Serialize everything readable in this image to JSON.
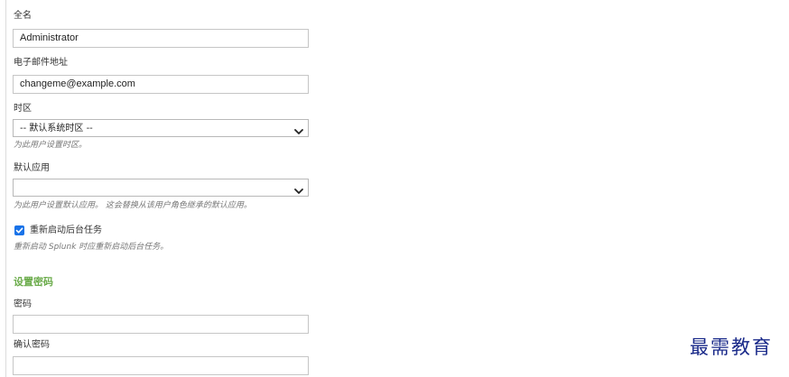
{
  "form": {
    "full_name": {
      "label": "全名",
      "value": "Administrator"
    },
    "email": {
      "label": "电子邮件地址",
      "value": "changeme@example.com"
    },
    "timezone": {
      "label": "时区",
      "selected": "-- 默认系统时区 --",
      "help": "为此用户设置时区。"
    },
    "default_app": {
      "label": "默认应用",
      "selected": "",
      "help": "为此用户设置默认应用。 这会替换从该用户角色继承的默认应用。"
    },
    "restart_background_jobs": {
      "label": "重新启动后台任务",
      "checked": true,
      "help": "重新启动 Splunk 时应重新启动后台任务。"
    }
  },
  "password_section": {
    "title": "设置密码",
    "password_label": "密码",
    "password_value": "",
    "confirm_label": "确认密码",
    "confirm_value": ""
  },
  "watermark": {
    "text": "最需教育"
  },
  "colors": {
    "section_title": "#6cac4c",
    "checkbox": "#1a73e8",
    "watermark": "#1a2a8a"
  },
  "icons": {
    "select_arrow": "chevron-down-icon",
    "checkbox_mark": "checkmark-icon"
  }
}
